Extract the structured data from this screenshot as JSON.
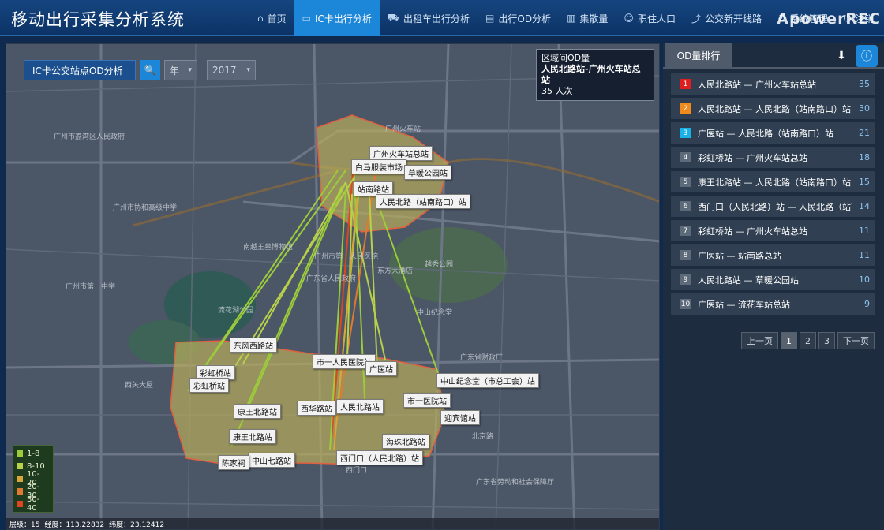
{
  "header": {
    "title": "移动出行采集分析系统",
    "nav": [
      {
        "label": "首页",
        "icon": "home-icon",
        "active": false
      },
      {
        "label": "IC卡出行分析",
        "icon": "card-icon",
        "active": true
      },
      {
        "label": "出租车出行分析",
        "icon": "taxi-icon",
        "active": false
      },
      {
        "label": "出行OD分析",
        "icon": "document-icon",
        "active": false
      },
      {
        "label": "集散量",
        "icon": "bar-chart-icon",
        "active": false
      },
      {
        "label": "职住人口",
        "icon": "person-icon",
        "active": false
      },
      {
        "label": "公交新开线路",
        "icon": "line-chart-icon",
        "active": false
      },
      {
        "label": "系统管理",
        "icon": "settings-icon",
        "active": false
      },
      {
        "label": "注销",
        "icon": "logout-icon",
        "active": false
      }
    ],
    "watermark": "ApowerREC"
  },
  "map": {
    "tool_title": "IC卡公交站点OD分析",
    "period_select": "年",
    "year_select": "2017",
    "popup": {
      "heading": "区域间OD量",
      "route": "人民北路站-广州火车站总站",
      "count": "35 人次"
    },
    "stations": [
      "广州火车站总站",
      "白马服装市场",
      "草暖公园站",
      "站南路站",
      "人民北路（站南路口）站",
      "东风西路站",
      "彩虹桥站",
      "市一人民医院站",
      "广医站",
      "中山纪念堂（市总工会）站",
      "市一医院站",
      "彩虹桥站",
      "西华路站",
      "人民北路站",
      "康王北路站",
      "迎宾馆站",
      "康王北路站",
      "海珠北路站",
      "西门口（人民北路）站",
      "中山七路站",
      "陈家祠"
    ],
    "map_labels": [
      "广州市荔湾区人民政府",
      "广州市协和高级中学",
      "广州市第一人民医院",
      "越秀公园",
      "东方大酒店",
      "流花湖公园",
      "西关大屋",
      "广东省财政厅",
      "广东省人民政府",
      "中山纪念堂",
      "广州火车站",
      "广州市第一中学",
      "西门口",
      "北京路",
      "广东省劳动和社会保障厅",
      "南越王墓博物馆"
    ],
    "legend": [
      {
        "label": "1-8",
        "color": "#9ccb3b"
      },
      {
        "label": "8-10",
        "color": "#b8d04a"
      },
      {
        "label": "10-20",
        "color": "#d8a63a"
      },
      {
        "label": "20-30",
        "color": "#e07a30"
      },
      {
        "label": "30-40",
        "color": "#e0451f"
      }
    ],
    "status": {
      "zoom": "层级：15",
      "lng": "经度：113.22832",
      "lat": "纬度：23.12412"
    }
  },
  "panel": {
    "tab": "OD量排行",
    "rankings": [
      {
        "rank": "1",
        "color": "#e01e1e",
        "name": "人民北路站 — 广州火车站总站",
        "count": "35"
      },
      {
        "rank": "2",
        "color": "#f08a1c",
        "name": "人民北路站 — 人民北路（站南路口）站",
        "count": "30"
      },
      {
        "rank": "3",
        "color": "#1ab0e8",
        "name": "广医站 — 人民北路（站南路口）站",
        "count": "21"
      },
      {
        "rank": "4",
        "color": "#5d6a7a",
        "name": "彩虹桥站 — 广州火车站总站",
        "count": "18"
      },
      {
        "rank": "5",
        "color": "#5d6a7a",
        "name": "康王北路站 — 人民北路（站南路口）站",
        "count": "15"
      },
      {
        "rank": "6",
        "color": "#5d6a7a",
        "name": "西门口（人民北路）站 — 人民北路（站南路口）站",
        "count": "14"
      },
      {
        "rank": "7",
        "color": "#5d6a7a",
        "name": "彩虹桥站 — 广州火车站总站",
        "count": "11"
      },
      {
        "rank": "8",
        "color": "#5d6a7a",
        "name": "广医站 — 站南路总站",
        "count": "11"
      },
      {
        "rank": "9",
        "color": "#5d6a7a",
        "name": "人民北路站 — 草暖公园站",
        "count": "10"
      },
      {
        "rank": "10",
        "color": "#5d6a7a",
        "name": "广医站 — 流花车站总站",
        "count": "9"
      }
    ],
    "pager": {
      "prev": "上一页",
      "pages": [
        "1",
        "2",
        "3"
      ],
      "current": "1",
      "next": "下一页"
    }
  }
}
